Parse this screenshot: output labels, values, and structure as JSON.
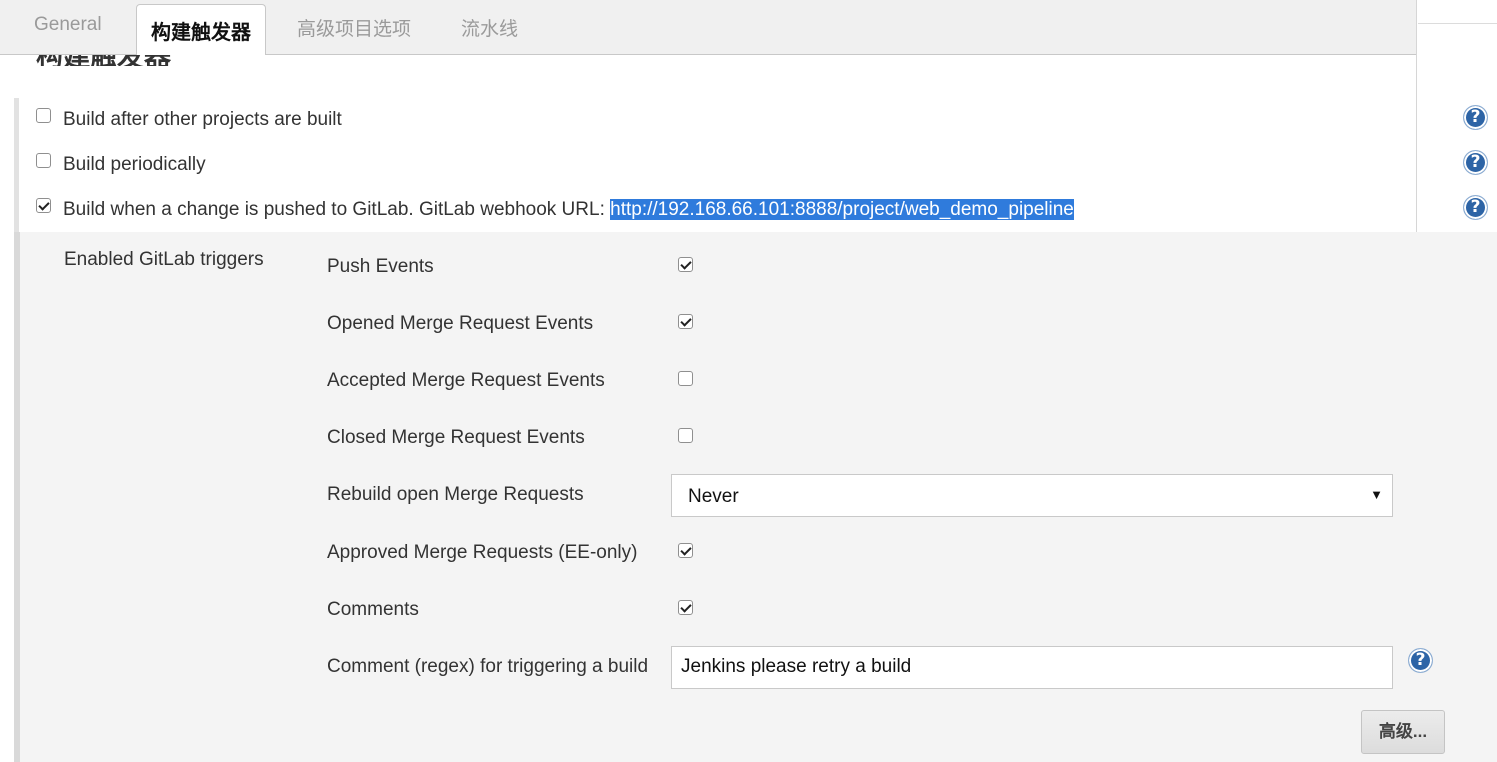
{
  "tabs": [
    {
      "label": "General",
      "active": false
    },
    {
      "label": "构建触发器",
      "active": true
    },
    {
      "label": "高级项目选项",
      "active": false
    },
    {
      "label": "流水线",
      "active": false
    }
  ],
  "section": {
    "heading": "构建触发器",
    "triggers": [
      {
        "label": "Build after other projects are built",
        "checked": false
      },
      {
        "label": "Build periodically",
        "checked": false
      },
      {
        "label": "Build when a change is pushed to GitLab. GitLab webhook URL:",
        "url": "http://192.168.66.101:8888/project/web_demo_pipeline",
        "checked": true
      }
    ]
  },
  "gitlab": {
    "group_label": "Enabled GitLab triggers",
    "options": [
      {
        "label": "Push Events",
        "checked": true
      },
      {
        "label": "Opened Merge Request Events",
        "checked": true
      },
      {
        "label": "Accepted Merge Request Events",
        "checked": false
      },
      {
        "label": "Closed Merge Request Events",
        "checked": false
      },
      {
        "label": "Rebuild open Merge Requests"
      },
      {
        "label": "Approved Merge Requests (EE-only)",
        "checked": true
      },
      {
        "label": "Comments",
        "checked": true
      },
      {
        "label": "Comment (regex) for triggering a build"
      }
    ],
    "rebuild_select_value": "Never",
    "comment_regex_value": "Jenkins please retry a build",
    "advanced_button": "高级..."
  },
  "help_icon_glyph": "?",
  "colors": {
    "url_highlight": "#2f7bdc",
    "help_icon": "#2d64a6"
  }
}
